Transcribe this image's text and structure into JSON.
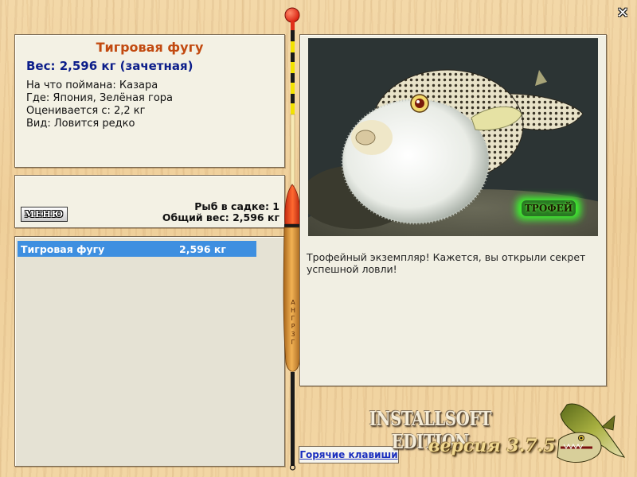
{
  "fish": {
    "name": "Тигровая фугу",
    "weight": "Вес: 2,596 кг (зачетная)",
    "bait": "На что поймана: Казара",
    "location": "Где: Япония, Зелёная гора",
    "valued_from": "Оценивается с: 2,2 кг",
    "kind": "Вид: Ловится редко"
  },
  "stats": {
    "menu_label": "МЕНЮ",
    "fish_count": "Рыб в садке: 1",
    "total_weight": "Общий вес: 2,596 кг"
  },
  "catch_list": [
    {
      "name": "Тигровая фугу",
      "weight": "2,596 кг"
    }
  ],
  "photo": {
    "badge": "ТРОФЕЙ",
    "description": "Трофейный экземпляр! Кажется, вы открыли секрет успешной ловли!"
  },
  "hotkeys_label": "Горячие клавиши",
  "edition_text": "INSTALLSOFT EDITION",
  "version_text": "версия 3.7.5",
  "float_markings": [
    "А",
    "Н",
    "Г",
    "Р",
    "3",
    "Г"
  ],
  "colors": {
    "title": "#c24a10",
    "weight": "#0c1e8a",
    "selection": "#3e8fe0",
    "link": "#1b2fbf",
    "trophy_glow": "#39ff2a"
  }
}
